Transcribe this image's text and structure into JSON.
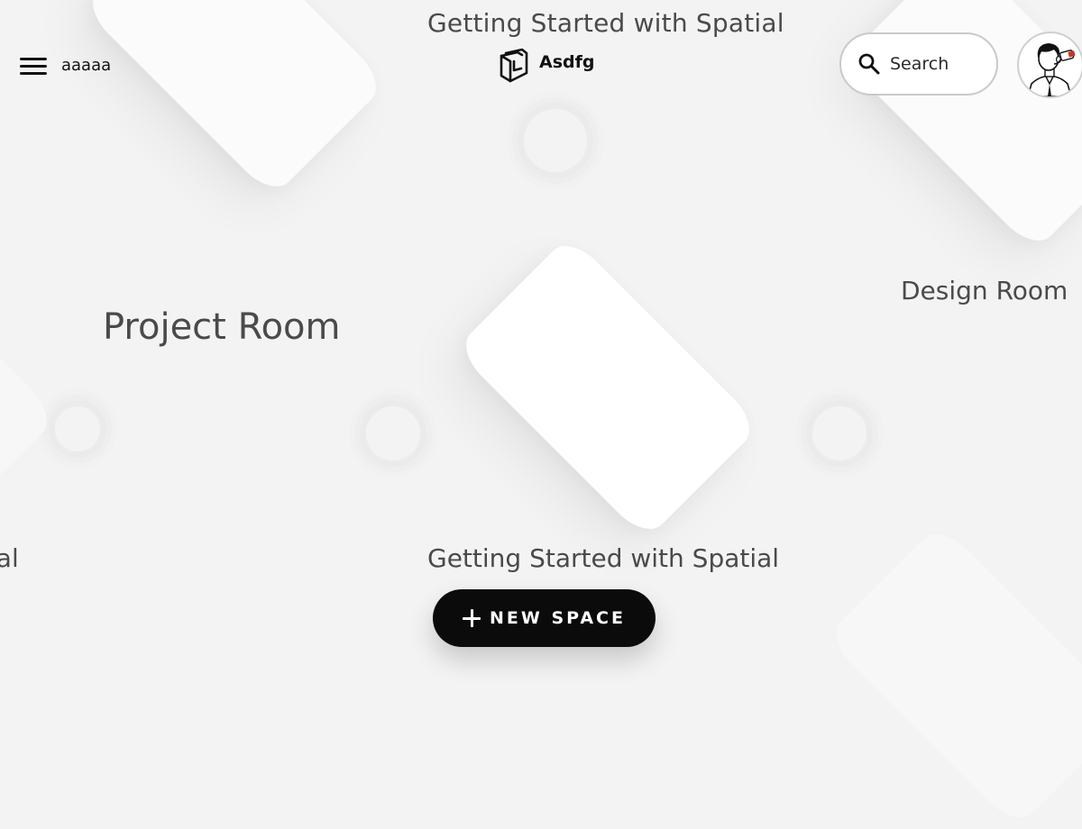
{
  "header": {
    "menu_icon": "hamburger-menu-icon",
    "workspace_name": "aaaaa",
    "brand_name": "Asdfg",
    "brand_icon": "cube-logo-icon",
    "search": {
      "icon": "search-icon",
      "label": "Search"
    },
    "avatar_icon": "user-avatar"
  },
  "rooms": [
    {
      "label": "Getting Started with Spatial"
    },
    {
      "label": "Project Room"
    },
    {
      "label": "Design Room"
    },
    {
      "label": "Getting Started with Spatial"
    },
    {
      "label": "ial"
    }
  ],
  "new_space": {
    "icon": "plus-icon",
    "label": "NEW SPACE"
  },
  "colors": {
    "background": "#f3f3f3",
    "tile": "#fbfbfb",
    "text": "#4a4a4a",
    "button": "#0b0b0b",
    "button_text": "#ffffff"
  }
}
